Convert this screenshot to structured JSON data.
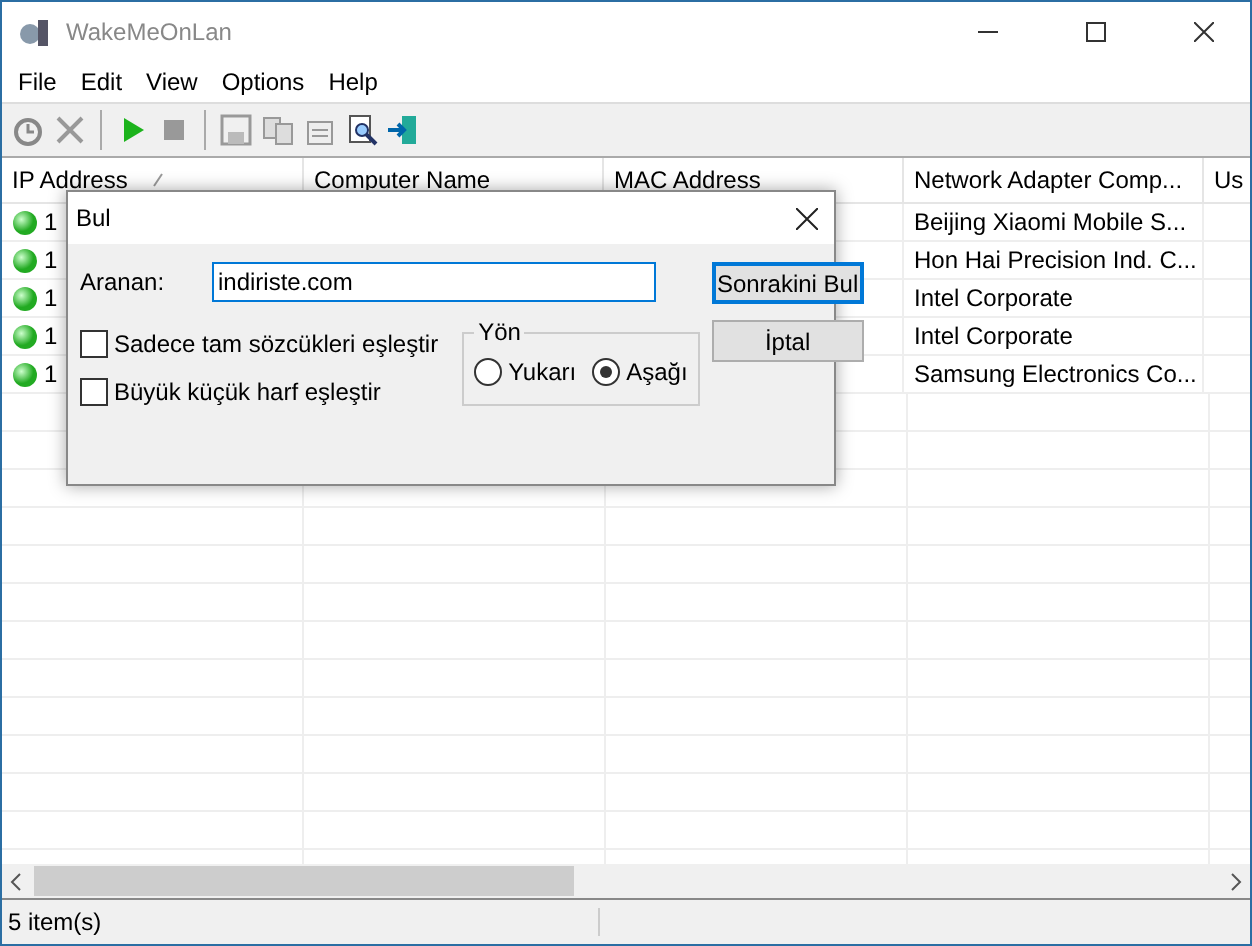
{
  "window": {
    "title": "WakeMeOnLan"
  },
  "menu": [
    "File",
    "Edit",
    "View",
    "Options",
    "Help"
  ],
  "table": {
    "columns": [
      {
        "label": "IP Address",
        "sorted": true
      },
      {
        "label": "Computer Name",
        "sorted": false
      },
      {
        "label": "MAC Address",
        "sorted": false
      },
      {
        "label": "Network Adapter Comp...",
        "sorted": false
      },
      {
        "label": "Us",
        "sorted": false
      }
    ],
    "rows": [
      {
        "ip": "1",
        "adapter": "Beijing Xiaomi Mobile S..."
      },
      {
        "ip": "1",
        "adapter": "Hon Hai Precision Ind. C..."
      },
      {
        "ip": "1",
        "adapter": "Intel Corporate"
      },
      {
        "ip": "1",
        "adapter": "Intel Corporate"
      },
      {
        "ip": "1",
        "adapter": "Samsung Electronics Co..."
      }
    ]
  },
  "dialog": {
    "title": "Bul",
    "search_label": "Aranan:",
    "search_value": "indiriste.com",
    "buttons": [
      {
        "label": "Sonrakini Bul",
        "default": true
      },
      {
        "label": "İptal",
        "default": false
      }
    ],
    "checkboxes": [
      {
        "label": "Sadece tam sözcükleri eşleştir",
        "checked": false
      },
      {
        "label": "Büyük küçük harf eşleştir",
        "checked": false
      }
    ],
    "direction": {
      "title": "Yön",
      "options": [
        {
          "label": "Yukarı",
          "selected": false
        },
        {
          "label": "Aşağı",
          "selected": true
        }
      ]
    }
  },
  "status_bar": "5 item(s)"
}
